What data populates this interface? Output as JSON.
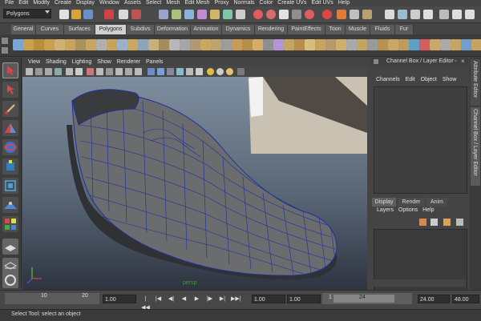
{
  "menu_bar": [
    "File",
    "Edit",
    "Modify",
    "Create",
    "Display",
    "Window",
    "Assets",
    "Select",
    "Mesh",
    "Edit Mesh",
    "Proxy",
    "Normals",
    "Color",
    "Create UVs",
    "Edit UVs",
    "Help"
  ],
  "status_line": {
    "mode": "Polygons"
  },
  "shelf_tabs": [
    {
      "label": "General"
    },
    {
      "label": "Curves"
    },
    {
      "label": "Surfaces"
    },
    {
      "label": "Polygons",
      "active": true
    },
    {
      "label": "Subdivs"
    },
    {
      "label": "Deformation"
    },
    {
      "label": "Animation"
    },
    {
      "label": "Dynamics"
    },
    {
      "label": "Rendering"
    },
    {
      "label": "PaintEffects"
    },
    {
      "label": "Toon"
    },
    {
      "label": "Muscle"
    },
    {
      "label": "Fluids"
    },
    {
      "label": "Fur"
    }
  ],
  "panel_menu": [
    "View",
    "Shading",
    "Lighting",
    "Show",
    "Renderer",
    "Panels"
  ],
  "viewport": {
    "camera_label": "persp"
  },
  "channel_box": {
    "title": "Channel Box / Layer Editor",
    "menu": [
      "Channels",
      "Edit",
      "Object",
      "Show"
    ]
  },
  "layer_editor": {
    "tabs": [
      {
        "label": "Display",
        "active": true
      },
      {
        "label": "Render"
      },
      {
        "label": "Anim"
      }
    ],
    "menu": [
      "Layers",
      "Options",
      "Help"
    ]
  },
  "side_tabs": [
    "Attribute Editor",
    "Channel Box / Layer Editor"
  ],
  "time_slider": {
    "ticks": [
      "10",
      "20"
    ],
    "current_time": "1.00",
    "start_time": "1.00",
    "playback_start": "1.00",
    "range_start": "1",
    "range_end": "24",
    "playback_end": "24.00",
    "end_time": "48.00"
  },
  "playback_icons": [
    "go-to-start-icon",
    "step-back-frame-icon",
    "step-back-key-icon",
    "play-backwards-icon",
    "play-forwards-icon",
    "step-forward-key-icon",
    "step-forward-frame-icon",
    "go-to-end-icon"
  ],
  "help_line": {
    "text": "Select Tool: select an object"
  },
  "colors": {
    "accent": "#e8a53c",
    "active_tab": "#d0d0d0",
    "wireframe": "#1f2fa0",
    "background": "#444444"
  }
}
